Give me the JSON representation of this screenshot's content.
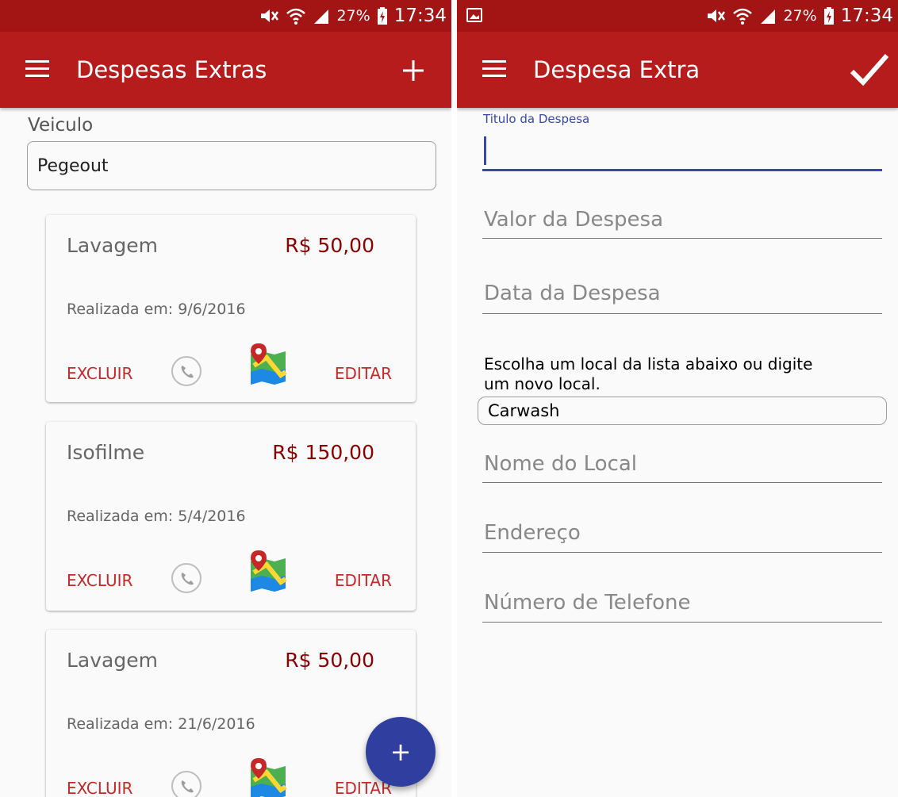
{
  "status_bar": {
    "battery": "27%",
    "time": "17:34"
  },
  "left_screen": {
    "app_bar": {
      "title": "Despesas Extras"
    },
    "vehicle_label": "Veiculo",
    "vehicle_selected": "Pegeout",
    "cards": [
      {
        "title": "Lavagem",
        "value": "R$ 50,00",
        "date": "Realizada em: 9/6/2016",
        "delete_label": "EXCLUIR",
        "edit_label": "EDITAR"
      },
      {
        "title": "Isofilme",
        "value": "R$ 150,00",
        "date": "Realizada em: 5/4/2016",
        "delete_label": "EXCLUIR",
        "edit_label": "EDITAR"
      },
      {
        "title": "Lavagem",
        "value": "R$ 50,00",
        "date": "Realizada em: 21/6/2016",
        "delete_label": "EXCLUIR",
        "edit_label": "EDITAR"
      }
    ],
    "fab_label": "+"
  },
  "right_screen": {
    "app_bar": {
      "title": "Despesa Extra"
    },
    "title_field_label": "Titulo da Despesa",
    "title_field_value": "",
    "value_placeholder": "Valor da Despesa",
    "date_placeholder": "Data da Despesa",
    "location_hint": "Escolha um local da lista abaixo ou digite um novo local.",
    "location_selected": "Carwash",
    "location_name_placeholder": "Nome do Local",
    "address_placeholder": "Endereço",
    "phone_placeholder": "Número de Telefone"
  },
  "colors": {
    "status_bar": "#a31515",
    "app_bar": "#b71c1c",
    "accent": "#3949ab",
    "fab": "#303f9f",
    "price": "#8b0000",
    "action_text": "#c62828"
  },
  "icons": {
    "menu": "menu-icon",
    "add": "plus-icon",
    "confirm": "check-icon",
    "phone": "phone-icon",
    "map": "map-icon",
    "mute": "mute-icon",
    "wifi": "wifi-icon",
    "signal": "signal-icon",
    "battery": "battery-charging-icon",
    "gallery": "image-notification-icon"
  }
}
